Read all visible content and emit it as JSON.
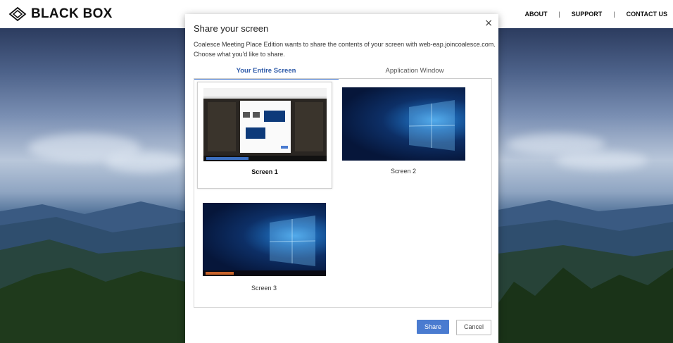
{
  "header": {
    "logo_text": "BLACK BOX",
    "nav": [
      "ABOUT",
      "SUPPORT",
      "CONTACT US"
    ]
  },
  "dialog": {
    "title": "Share your screen",
    "description": "Coalesce Meeting Place Edition wants to share the contents of your screen with web-eap.joincoalesce.com. Choose what you'd like to share.",
    "tabs": [
      {
        "label": "Your Entire Screen",
        "active": true
      },
      {
        "label": "Application Window",
        "active": false
      }
    ],
    "screens": [
      {
        "label": "Screen 1",
        "selected": true
      },
      {
        "label": "Screen 2",
        "selected": false
      },
      {
        "label": "Screen 3",
        "selected": false
      }
    ],
    "close_icon": "×",
    "share_label": "Share",
    "cancel_label": "Cancel"
  },
  "colors": {
    "accent": "#4a7bd0",
    "active_tab_text": "#2e5aa8"
  }
}
